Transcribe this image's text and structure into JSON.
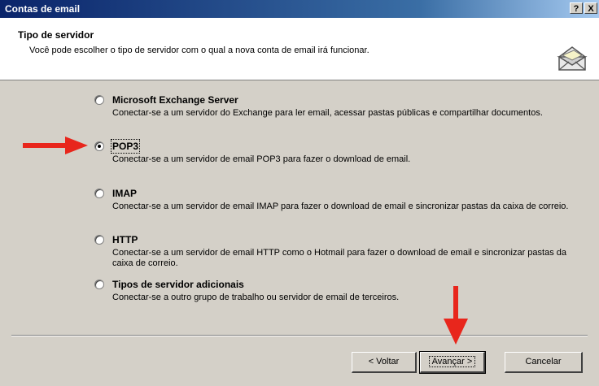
{
  "window": {
    "title": "Contas de email",
    "help_glyph": "?",
    "close_glyph": "X"
  },
  "header": {
    "title": "Tipo de servidor",
    "subtitle": "Você pode escolher o tipo de servidor com o qual a nova conta de email irá funcionar."
  },
  "options": [
    {
      "label": "Microsoft Exchange Server",
      "description": "Conectar-se a um servidor do Exchange para ler email, acessar pastas públicas e compartilhar documentos.",
      "selected": false
    },
    {
      "label": "POP3",
      "description": "Conectar-se a um servidor de email POP3 para fazer o download de email.",
      "selected": true
    },
    {
      "label": "IMAP",
      "description": "Conectar-se a um servidor de email IMAP para fazer o download de email e sincronizar pastas da caixa de correio.",
      "selected": false
    },
    {
      "label": "HTTP",
      "description": "Conectar-se a um servidor de email HTTP como o Hotmail para fazer o download de email e sincronizar pastas da caixa de correio.",
      "selected": false
    },
    {
      "label": "Tipos de servidor adicionais",
      "description": "Conectar-se a outro grupo de trabalho ou servidor de email de terceiros.",
      "selected": false
    }
  ],
  "buttons": {
    "back": "< Voltar",
    "next": "Avançar >",
    "cancel": "Cancelar"
  },
  "colors": {
    "annotation_arrow": "#e8261c",
    "titlebar": "#0a246a"
  }
}
